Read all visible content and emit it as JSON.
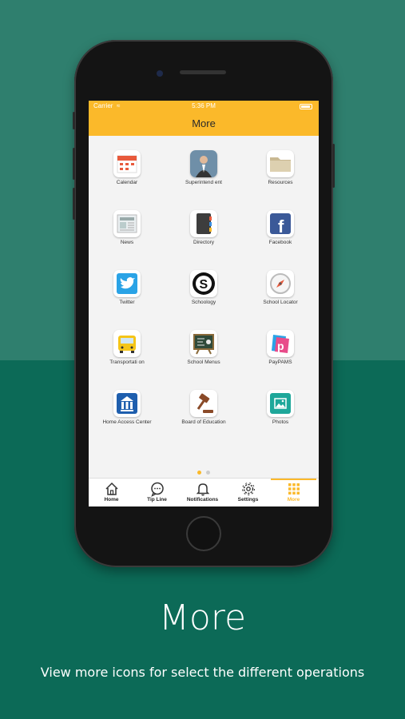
{
  "status_bar": {
    "carrier": "Carrier",
    "time": "5:36 PM"
  },
  "nav": {
    "title": "More"
  },
  "tiles": [
    {
      "label": "Calendar",
      "icon": "calendar-icon"
    },
    {
      "label": "Superintend ent",
      "icon": "superintendent-photo"
    },
    {
      "label": "Resources",
      "icon": "folder-icon"
    },
    {
      "label": "News",
      "icon": "newspaper-icon"
    },
    {
      "label": "Directory",
      "icon": "directory-book-icon"
    },
    {
      "label": "Facebook",
      "icon": "facebook-icon"
    },
    {
      "label": "Twitter",
      "icon": "twitter-icon"
    },
    {
      "label": "Schoology",
      "icon": "schoology-icon"
    },
    {
      "label": "School Locator",
      "icon": "compass-icon"
    },
    {
      "label": "Transportati on",
      "icon": "school-bus-icon"
    },
    {
      "label": "School Menus",
      "icon": "menu-board-icon"
    },
    {
      "label": "PayPAMS",
      "icon": "paypams-icon"
    },
    {
      "label": "Home Access Center",
      "icon": "home-access-icon"
    },
    {
      "label": "Board of Education",
      "icon": "gavel-icon"
    },
    {
      "label": "Photos",
      "icon": "photos-icon"
    }
  ],
  "pager": {
    "pages": 2,
    "current": 1
  },
  "tabs": [
    {
      "label": "Home",
      "icon": "home-icon"
    },
    {
      "label": "Tip Line",
      "icon": "chat-bubble-icon"
    },
    {
      "label": "Notifications",
      "icon": "bell-icon"
    },
    {
      "label": "Settings",
      "icon": "gear-icon"
    },
    {
      "label": "More",
      "icon": "grid-icon"
    }
  ],
  "caption": {
    "title": "More",
    "subtitle": "View more icons for select the different operations"
  },
  "colors": {
    "accent": "#fbb92a",
    "background_top": "#2f7f6e",
    "background_bottom": "#0c6a57"
  }
}
